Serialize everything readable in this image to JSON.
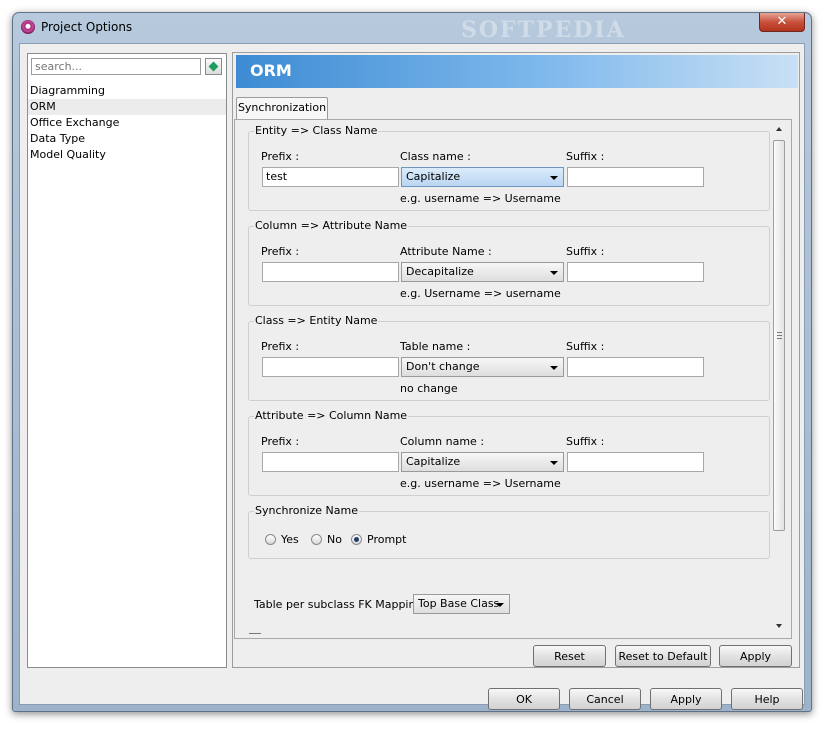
{
  "window": {
    "title": "Project Options",
    "watermark": "SOFTPEDIA",
    "close_glyph": "✕"
  },
  "sidebar": {
    "search_placeholder": "search...",
    "items": [
      {
        "label": "Diagramming"
      },
      {
        "label": "ORM",
        "selected": true
      },
      {
        "label": "Office Exchange"
      },
      {
        "label": "Data Type"
      },
      {
        "label": "Model Quality"
      }
    ]
  },
  "header": {
    "title": "ORM"
  },
  "tabs": [
    {
      "label": "Synchronization"
    }
  ],
  "labels": {
    "prefix": "Prefix :",
    "suffix": "Suffix :"
  },
  "groups": [
    {
      "title": "Entity => Class Name",
      "middle_label": "Class name :",
      "prefix_value": "test",
      "combo_value": "Capitalize",
      "suffix_value": "",
      "hint": "e.g. username => Username"
    },
    {
      "title": "Column => Attribute Name",
      "middle_label": "Attribute Name :",
      "prefix_value": "",
      "combo_value": "Decapitalize",
      "suffix_value": "",
      "hint": "e.g. Username => username"
    },
    {
      "title": "Class => Entity Name",
      "middle_label": "Table name :",
      "prefix_value": "",
      "combo_value": "Don't change",
      "suffix_value": "",
      "hint": "no change"
    },
    {
      "title": "Attribute => Column Name",
      "middle_label": "Column name :",
      "prefix_value": "",
      "combo_value": "Capitalize",
      "suffix_value": "",
      "hint": "e.g. username => Username"
    }
  ],
  "sync_name": {
    "title": "Synchronize Name",
    "options": [
      {
        "label": "Yes",
        "checked": false
      },
      {
        "label": "No",
        "checked": false
      },
      {
        "label": "Prompt",
        "checked": true
      }
    ]
  },
  "fk_mapping": {
    "label": "Table per subclass FK Mapping :",
    "value": "Top Base Class"
  },
  "panel_buttons": {
    "reset": "Reset",
    "reset_default": "Reset to Default",
    "apply": "Apply"
  },
  "dialog_buttons": {
    "ok": "OK",
    "cancel": "Cancel",
    "apply": "Apply",
    "help": "Help"
  },
  "colors": {
    "header_gradient_start": "#3d8bd3",
    "header_gradient_end": "#c9e0f5",
    "combo_active": "#b9d5f2",
    "close_button": "#c8513c"
  }
}
